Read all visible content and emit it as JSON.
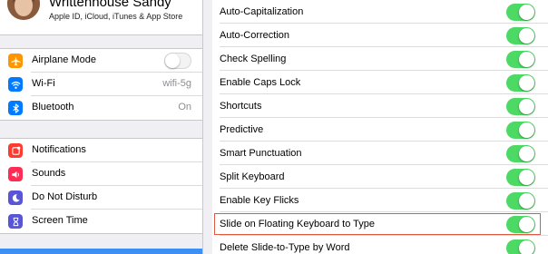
{
  "profile": {
    "name": "Writtenhouse Sandy",
    "subtitle": "Apple ID, iCloud, iTunes & App Store"
  },
  "sidebar": {
    "group1": [
      {
        "label": "Airplane Mode",
        "icon": "airplane-icon",
        "icon_color": "#ff9500",
        "control": "toggle",
        "on": false
      },
      {
        "label": "Wi-Fi",
        "icon": "wifi-icon",
        "icon_color": "#007aff",
        "value": "wifi-5g"
      },
      {
        "label": "Bluetooth",
        "icon": "bluetooth-icon",
        "icon_color": "#007aff",
        "value": "On"
      }
    ],
    "group2": [
      {
        "label": "Notifications",
        "icon": "notifications-icon",
        "icon_color": "#ff3b30"
      },
      {
        "label": "Sounds",
        "icon": "sounds-icon",
        "icon_color": "#ff2d55"
      },
      {
        "label": "Do Not Disturb",
        "icon": "moon-icon",
        "icon_color": "#5856d6"
      },
      {
        "label": "Screen Time",
        "icon": "hourglass-icon",
        "icon_color": "#5856d6"
      }
    ]
  },
  "keyboard_settings": {
    "toggle_on_color": "#4cd964",
    "highlight_color": "#e0583f",
    "items": [
      {
        "label": "Auto-Capitalization",
        "on": true
      },
      {
        "label": "Auto-Correction",
        "on": true
      },
      {
        "label": "Check Spelling",
        "on": true
      },
      {
        "label": "Enable Caps Lock",
        "on": true
      },
      {
        "label": "Shortcuts",
        "on": true
      },
      {
        "label": "Predictive",
        "on": true
      },
      {
        "label": "Smart Punctuation",
        "on": true
      },
      {
        "label": "Split Keyboard",
        "on": true
      },
      {
        "label": "Enable Key Flicks",
        "on": true
      },
      {
        "label": "Slide on Floating Keyboard to Type",
        "on": true,
        "highlighted": true
      },
      {
        "label": "Delete Slide-to-Type by Word",
        "on": true
      }
    ]
  }
}
